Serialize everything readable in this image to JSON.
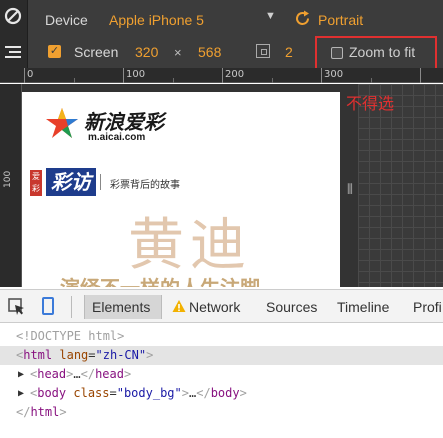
{
  "emulation": {
    "device_label": "Device",
    "device_value": "Apple iPhone 5",
    "orientation_label": "Portrait",
    "screen_label": "Screen",
    "screen_width": "320",
    "times_symbol": "×",
    "screen_height": "568",
    "pixel_ratio": "2",
    "zoom_to_fit_label": "Zoom to fit",
    "accent_color": "#f0a030"
  },
  "ruler": {
    "labels": [
      "0",
      "100",
      "200",
      "300"
    ],
    "vertical_label": "100"
  },
  "overlay_note": "不得选",
  "page_preview": {
    "logo_cn": "新浪爱彩",
    "logo_en": "m.aicai.com",
    "badge": "爱彩",
    "brand": "彩访",
    "subtitle": "彩票背后的故事",
    "headline": "黄迪",
    "tagline": "演绎不一样的人生注脚"
  },
  "devtools": {
    "tabs": [
      "Elements",
      "Network",
      "Sources",
      "Timeline",
      "Profi"
    ],
    "dom": {
      "doctype": "<!DOCTYPE html>",
      "html_tag": "html",
      "html_attr_name": "lang",
      "html_attr_value": "\"zh-CN\"",
      "head_tag": "head",
      "head_close": "head",
      "body_tag": "body",
      "body_attr_name": "class",
      "body_attr_value": "\"body_bg\"",
      "body_close": "body",
      "html_close": "html",
      "ellipsis": "…"
    }
  }
}
